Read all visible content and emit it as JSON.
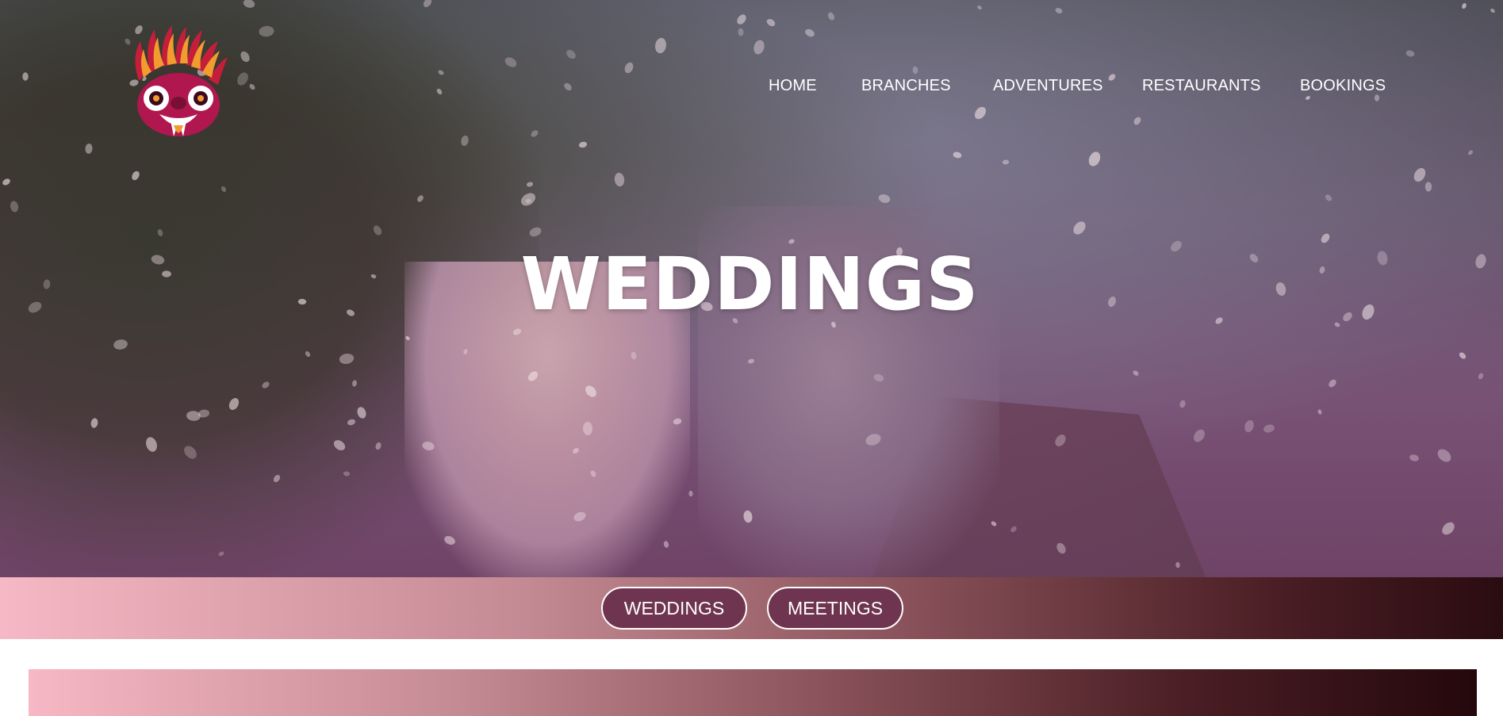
{
  "brand": {
    "logo": "devil-mask-logo"
  },
  "nav": {
    "items": [
      {
        "label": "HOME"
      },
      {
        "label": "BRANCHES"
      },
      {
        "label": "ADVENTURES"
      },
      {
        "label": "RESTAURANTS"
      },
      {
        "label": "BOOKINGS"
      }
    ]
  },
  "hero": {
    "title": "WEDDINGS",
    "image": "wedding-couple-confetti-photo"
  },
  "tabs": {
    "items": [
      {
        "label": "WEDDINGS"
      },
      {
        "label": "MEETINGS"
      }
    ]
  },
  "colors": {
    "tab_fill": "#6f3550",
    "gradient_start": "#f6b8c4",
    "gradient_end": "#2a0c10"
  }
}
